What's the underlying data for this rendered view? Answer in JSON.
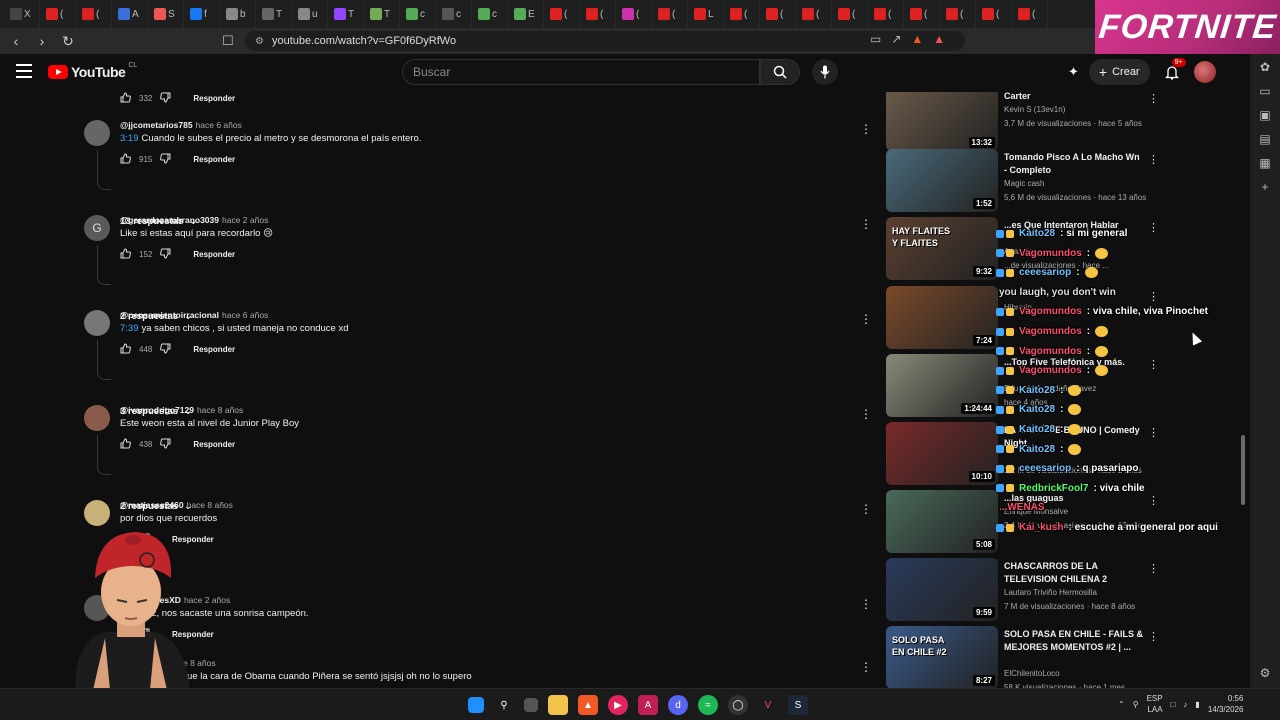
{
  "browser": {
    "tabs": [
      {
        "letter": "X",
        "color": "#444"
      },
      {
        "letter": "(",
        "color": "#d22"
      },
      {
        "letter": "(",
        "color": "#d22"
      },
      {
        "letter": "A",
        "color": "#3a6fd8"
      },
      {
        "letter": "S",
        "color": "#e55"
      },
      {
        "letter": "f",
        "color": "#1877f2"
      },
      {
        "letter": "b",
        "color": "#888"
      },
      {
        "letter": "T",
        "color": "#666"
      },
      {
        "letter": "u",
        "color": "#888"
      },
      {
        "letter": "T",
        "color": "#9146ff"
      },
      {
        "letter": "T",
        "color": "#7a5"
      },
      {
        "letter": "c",
        "color": "#5a5"
      },
      {
        "letter": "c",
        "color": "#555"
      },
      {
        "letter": "c",
        "color": "#5a5"
      },
      {
        "letter": "E",
        "color": "#5a5"
      },
      {
        "letter": "(",
        "color": "#d22"
      },
      {
        "letter": "(",
        "color": "#d22"
      },
      {
        "letter": "(",
        "color": "#c3a"
      },
      {
        "letter": "(",
        "color": "#d22"
      },
      {
        "letter": "L",
        "color": "#d22"
      },
      {
        "letter": "(",
        "color": "#d22"
      },
      {
        "letter": "(",
        "color": "#d22"
      },
      {
        "letter": "(",
        "color": "#d22"
      },
      {
        "letter": "(",
        "color": "#d22"
      },
      {
        "letter": "(",
        "color": "#d22"
      },
      {
        "letter": "(",
        "color": "#d22"
      },
      {
        "letter": "(",
        "color": "#d22"
      },
      {
        "letter": "(",
        "color": "#d22"
      },
      {
        "letter": "(",
        "color": "#d22"
      }
    ],
    "url": "youtube.com/watch?v=GF0f6DyRfWo",
    "banner_text": "FORTNITE"
  },
  "header": {
    "logo_text": "YouTube",
    "country": "CL",
    "search_placeholder": "Buscar",
    "create_label": "Crear",
    "notif_badge": "9+"
  },
  "comments": [
    {
      "likes": "332",
      "reply": "Responder",
      "partial": true
    },
    {
      "author": "@jjcometarios785",
      "ago": "hace 6 años",
      "ts": "3:19",
      "text": "Cuando le subes el precio al metro y se desmorona el país entero.",
      "likes": "915",
      "reply": "Responder",
      "replies": "13 respuestas",
      "avatar": "#666"
    },
    {
      "author": "@gerardozambrano3039",
      "ago": "hace 2 años",
      "ts": "",
      "text": "Like si estas aquí para recordarlo 😢",
      "likes": "152",
      "reply": "Responder",
      "replies": "2 respuestas",
      "avatar": "#5a5a5a",
      "initial": "G"
    },
    {
      "author": "@pensamientoirracional",
      "ago": "hace 6 años",
      "ts": "7:39",
      "text": "ya saben chicos , si usted maneja no conduce xd",
      "likes": "448",
      "reply": "Responder",
      "replies": "3 respuestas",
      "avatar": "#777"
    },
    {
      "author": "@ivanrodrigo7129",
      "ago": "hace 8 años",
      "ts": "",
      "text": "Este weon esta al nivel de Junior Play Boy",
      "likes": "438",
      "reply": "Responder",
      "replies": "2 respuestas",
      "avatar": "#8a5a4a"
    },
    {
      "author": "@matiasss2460",
      "ago": "hace 8 años",
      "ts": "",
      "text": "por dios que recuerdos",
      "likes": "",
      "reply": "Responder",
      "replies": "",
      "avatar": "#c9b27a"
    },
    {
      "author": "...duccionesXD",
      "ago": "hace 2 años",
      "ts": "",
      "text": "...en paz, nos sacaste una sonrisa campeón.",
      "likes": "",
      "reply": "Responder",
      "replies": "",
      "avatar": "#555"
    },
    {
      "author": "...do-sw3oe",
      "ago": "hace 8 años",
      "ts": "",
      "text": "...s me dio risa fue la cara de Obama cuando Piñera se sentó jsjsjsj oh no lo supero",
      "likes": "",
      "reply": "",
      "replies": "",
      "avatar": "#555"
    }
  ],
  "related": [
    {
      "title": "Carter",
      "channel": "Kevin S (13ev1n)",
      "meta": "3,7 M de visualizaciones · hace 5 años",
      "duration": "13:32",
      "bg": "#6b5a4a"
    },
    {
      "title": "Tomando Pisco A Lo Macho Wn - Completo",
      "channel": "Magic cash",
      "meta": "5,6 M de visualizaciones · hace 13 años",
      "duration": "1:52",
      "bg": "#4a6a7a"
    },
    {
      "title": "...es Que Intentaron Hablar",
      "channel": "Analistos...",
      "meta": "...de visualizaciones · hace ...",
      "duration": "9:32",
      "bg": "#5a4030",
      "thumbtext": "HAY FLAITES Y FLAITES"
    },
    {
      "title": "",
      "channel": "Hibrarin",
      "meta": "",
      "duration": "7:24",
      "bg": "#7a4a2a"
    },
    {
      "title": "...Top Five Telefónica y más.",
      "channel": "Eduardo Avendaño Pavez",
      "meta": "hace 4 años",
      "duration": "1:24:44",
      "bg": "#8a8a7a"
    },
    {
      "title": "LA MAMÁ DE BRUNO | Comedy Night",
      "channel": "",
      "meta": "1,2 M de visualizaciones · hace 2 años",
      "duration": "10:10",
      "bg": "#7a2a2a"
    },
    {
      "title": "...las guaguas",
      "channel": "Enrique Monsalve",
      "meta": "3,4 M de visualizaciones · hace 13 años",
      "duration": "5:08",
      "bg": "#4a6a5a"
    },
    {
      "title": "CHASCARROS DE LA TELEVISION CHILENA 2",
      "channel": "Lautaro Triviño Hermosilla",
      "meta": "7 M de visualizaciones · hace 8 años",
      "duration": "9:59",
      "bg": "#2a3a5a"
    },
    {
      "title": "SOLO PASA EN CHILE - FAILS & MEJORES MOMENTOS #2 | ...",
      "channel": "ElChilenitoLoco",
      "meta": "58 K visualizaciones · hace 1 mes",
      "duration": "8:27",
      "bg": "#3a5a8a",
      "thumbtext": "SOLO PASA EN CHILE #2"
    }
  ],
  "chat": [
    {
      "user": "Kaito28",
      "msg": ": si mi general",
      "color": "#6fc3ff"
    },
    {
      "user": "Vagomundos",
      "msg": ":",
      "color": "#ff4d6d"
    },
    {
      "user": "ceeesariop",
      "msg": ":",
      "color": "#6fc3ff"
    },
    {
      "user": "",
      "msg": "you laugh, you don't win",
      "color": "#ddd"
    },
    {
      "user": "Vagomundos",
      "msg": ": viva chile, viva Pinochet",
      "color": "#ff4d6d"
    },
    {
      "user": "Vagomundos",
      "msg": ":",
      "color": "#ff4d6d"
    },
    {
      "user": "Vagomundos",
      "msg": ":",
      "color": "#ff4d6d"
    },
    {
      "user": "Vagomundos",
      "msg": ":",
      "color": "#ff4d6d"
    },
    {
      "user": "Kaito28",
      "msg": ":",
      "color": "#6fc3ff"
    },
    {
      "user": "Kaito28",
      "msg": ":",
      "color": "#6fc3ff"
    },
    {
      "user": "Kaito28",
      "msg": ":",
      "color": "#6fc3ff"
    },
    {
      "user": "Kaito28",
      "msg": ":",
      "color": "#6fc3ff"
    },
    {
      "user": "ceeesariop",
      "msg": ": q pasariapo",
      "color": "#6fc3ff"
    },
    {
      "user": "RedbrickFool7",
      "msg": ": viva chile",
      "color": "#4dff6b"
    },
    {
      "user": "",
      "msg": "...WENAS",
      "color": "#ff4d6d"
    },
    {
      "user": "Kai_kush",
      "msg": ": escuche a mi general por aqui",
      "color": "#ff4d6d"
    }
  ],
  "taskbar": {
    "lang_top": "ESP",
    "lang_bot": "LAA",
    "time": "0:56",
    "date": "14/3/2026"
  }
}
